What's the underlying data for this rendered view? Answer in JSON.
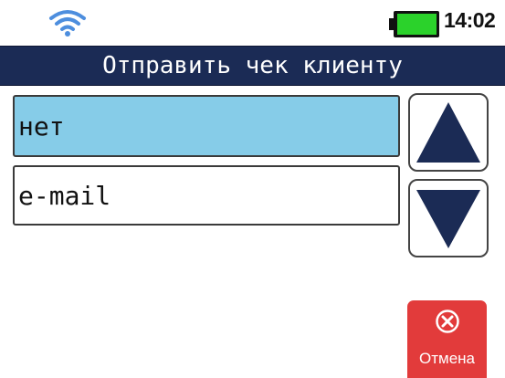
{
  "status_bar": {
    "wifi_icon": "wifi-icon",
    "battery_icon": "battery-icon",
    "battery_level": 1.0,
    "time": "14:02",
    "colors": {
      "wifi": "#4d8ede",
      "battery_fill": "#2bd22b"
    }
  },
  "header": {
    "title": "Отправить чек клиенту",
    "background": "#1b2b55"
  },
  "options": [
    {
      "label": "нет",
      "selected": true
    },
    {
      "label": "e-mail",
      "selected": false
    }
  ],
  "scroll_buttons": {
    "up_icon": "arrow-up-icon",
    "down_icon": "arrow-down-icon",
    "arrow_color": "#1b2b55"
  },
  "cancel_button": {
    "label": "Отмена",
    "icon": "close-circle-icon",
    "color": "#e23b3b"
  }
}
